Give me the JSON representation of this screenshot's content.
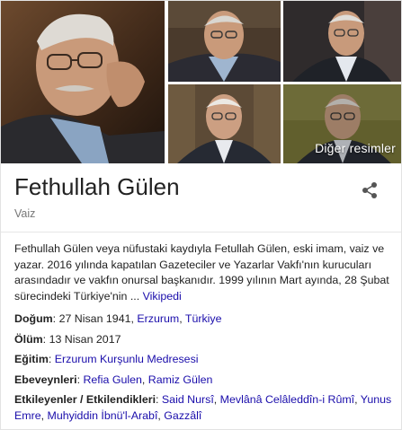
{
  "photos": {
    "main_alt": "Fethullah Gülen photo 1",
    "more_label": "Diğer resimler"
  },
  "entity": {
    "name": "Fethullah Gülen",
    "type": "Vaiz"
  },
  "description": {
    "text": "Fethullah Gülen veya nüfustaki kaydıyla Fetullah Gülen, eski imam, vaiz ve yazar. 2016 yılında kapatılan Gazeteciler ve Yazarlar Vakfı'nın kurucuları arasındadır ve vakfın onursal başkanıdır. 1999 yılının Mart ayında, 28 Şubat sürecindeki Türkiye'nin ...",
    "source_link": "Vikipedi"
  },
  "facts": {
    "birth": {
      "label": "Doğum",
      "date": "27 Nisan 1941",
      "place": "Erzurum",
      "country": "Türkiye"
    },
    "death": {
      "label": "Ölüm",
      "date": "13 Nisan 2017"
    },
    "education": {
      "label": "Eğitim",
      "school": "Erzurum Kurşunlu Medresesi"
    },
    "parents": {
      "label": "Ebeveynleri",
      "items": [
        "Refia Gulen",
        "Ramiz Gülen"
      ]
    },
    "influences": {
      "label": "Etkileyenler / Etkilendikleri",
      "items": [
        "Said Nursî",
        "Mevlânâ Celâleddîn-i Rûmî",
        "Yunus Emre",
        "Muhyiddin İbnü'l-Arabî",
        "Gazzâlî"
      ]
    }
  },
  "colors": {
    "link": "#1a0dab",
    "text": "#222222",
    "muted": "#777777",
    "divider": "#e6e6e6"
  }
}
